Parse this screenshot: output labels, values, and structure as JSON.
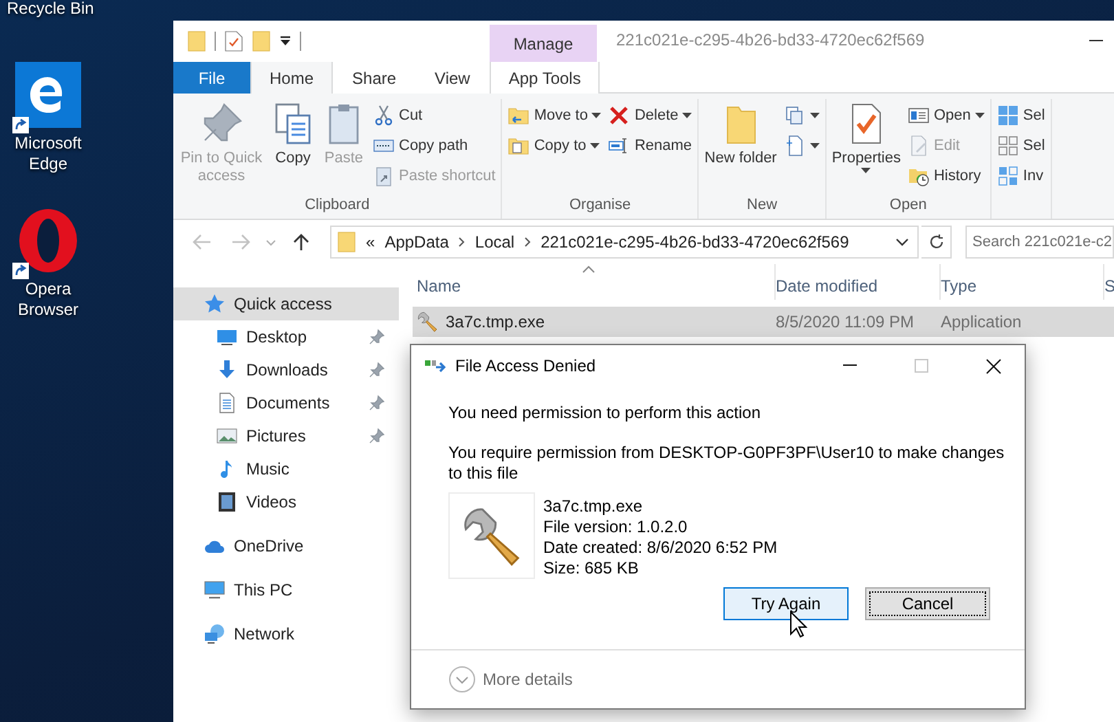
{
  "desktop": {
    "label": "Recycle Bin",
    "icons": [
      {
        "kind": "edge",
        "label": "Microsoft Edge"
      },
      {
        "kind": "opera",
        "label": "Opera Browser"
      }
    ]
  },
  "explorer": {
    "title": "221c021e-c295-4b26-bd33-4720ec62f569",
    "context_label": "Manage",
    "tabs": [
      {
        "label": "File",
        "kind": "menu",
        "selected": false
      },
      {
        "label": "Home",
        "kind": "tab",
        "selected": true
      },
      {
        "label": "Share",
        "kind": "tab",
        "selected": false
      },
      {
        "label": "View",
        "kind": "tab",
        "selected": false
      },
      {
        "label": "App Tools",
        "kind": "context",
        "selected": false
      }
    ],
    "ribbon": [
      {
        "name": "Clipboard",
        "columns": [
          {
            "kind": "large",
            "items": [
              {
                "kind": "pin",
                "label": "Pin to Quick access",
                "disabled": true,
                "dropdown": false
              }
            ]
          },
          {
            "kind": "large",
            "items": [
              {
                "kind": "copy",
                "label": "Copy",
                "disabled": false,
                "dropdown": false
              }
            ]
          },
          {
            "kind": "large",
            "items": [
              {
                "kind": "paste",
                "label": "Paste",
                "disabled": true,
                "dropdown": false
              }
            ]
          },
          {
            "kind": "stack",
            "items": [
              {
                "kind": "cut",
                "label": "Cut",
                "disabled": false,
                "dropdown": false
              },
              {
                "kind": "copypath",
                "label": "Copy path",
                "disabled": false,
                "dropdown": false
              },
              {
                "kind": "pasteshortcut",
                "label": "Paste shortcut",
                "disabled": true,
                "dropdown": false
              }
            ]
          }
        ]
      },
      {
        "name": "Organise",
        "columns": [
          {
            "kind": "stack",
            "items": [
              {
                "kind": "moveto",
                "label": "Move to",
                "disabled": false,
                "dropdown": true
              },
              {
                "kind": "copyto",
                "label": "Copy to",
                "disabled": false,
                "dropdown": true
              }
            ]
          },
          {
            "kind": "stack",
            "items": [
              {
                "kind": "delete",
                "label": "Delete",
                "disabled": false,
                "dropdown": true
              },
              {
                "kind": "rename",
                "label": "Rename",
                "disabled": false,
                "dropdown": false
              }
            ]
          }
        ]
      },
      {
        "name": "New",
        "columns": [
          {
            "kind": "large",
            "items": [
              {
                "kind": "newfolder",
                "label": "New folder",
                "disabled": false,
                "dropdown": false
              }
            ]
          },
          {
            "kind": "stack",
            "items": [
              {
                "kind": "newitem",
                "disabled": false,
                "dropdown": true
              },
              {
                "kind": "easyaccess",
                "disabled": false,
                "dropdown": true
              }
            ]
          }
        ]
      },
      {
        "name": "Open",
        "columns": [
          {
            "kind": "large",
            "items": [
              {
                "kind": "properties",
                "label": "Properties",
                "disabled": false,
                "dropdown": true
              }
            ]
          },
          {
            "kind": "stack",
            "items": [
              {
                "kind": "open",
                "label": "Open",
                "disabled": false,
                "dropdown": true
              },
              {
                "kind": "edit",
                "label": "Edit",
                "disabled": true,
                "dropdown": false
              },
              {
                "kind": "history",
                "label": "History",
                "disabled": false,
                "dropdown": false
              }
            ]
          }
        ]
      },
      {
        "columns": [
          {
            "kind": "stack",
            "items": [
              {
                "kind": "selectall",
                "label": "Sel",
                "disabled": false,
                "dropdown": false
              },
              {
                "kind": "selectnone",
                "label": "Sel",
                "disabled": false,
                "dropdown": false
              },
              {
                "kind": "invert",
                "label": "Inv",
                "disabled": false,
                "dropdown": false
              }
            ]
          }
        ]
      }
    ],
    "address": {
      "overflow": "«",
      "segments": [
        "AppData",
        "Local",
        "221c021e-c295-4b26-bd33-4720ec62f569"
      ]
    },
    "search": {
      "placeholder": "Search 221c021e-c2"
    },
    "nav": [
      {
        "label": "Quick access",
        "kind": "star",
        "selected": true,
        "pinned": false,
        "children": [
          {
            "label": "Desktop",
            "kind": "desktop",
            "selected": false,
            "pinned": true
          },
          {
            "label": "Downloads",
            "kind": "downloads",
            "selected": false,
            "pinned": true
          },
          {
            "label": "Documents",
            "kind": "documents",
            "selected": false,
            "pinned": true
          },
          {
            "label": "Pictures",
            "kind": "pictures",
            "selected": false,
            "pinned": true
          },
          {
            "label": "Music",
            "kind": "music",
            "selected": false,
            "pinned": false
          },
          {
            "label": "Videos",
            "kind": "videos",
            "selected": false,
            "pinned": false
          }
        ]
      },
      {
        "label": "OneDrive",
        "kind": "cloud",
        "selected": false,
        "pinned": false
      },
      {
        "label": "This PC",
        "kind": "pc",
        "selected": false,
        "pinned": false
      },
      {
        "label": "Network",
        "kind": "network",
        "selected": false,
        "pinned": false
      }
    ],
    "columns": [
      "Name",
      "Date modified",
      "Type",
      "S"
    ],
    "rows": [
      {
        "cells": [
          "3a7c.tmp.exe",
          "8/5/2020 11:09 PM",
          "Application"
        ],
        "selected": true
      }
    ]
  },
  "dialog": {
    "title": "File Access Denied",
    "heading": "You need permission to perform this action",
    "message": "You require permission from DESKTOP-G0PF3PF\\User10 to make changes to this file",
    "file_details": [
      "3a7c.tmp.exe",
      "File version: 1.0.2.0",
      "Date created: 8/6/2020 6:52 PM",
      "Size: 685 KB"
    ],
    "buttons": [
      {
        "label": "Try Again",
        "hovered": true,
        "focused": false
      },
      {
        "label": "Cancel",
        "hovered": false,
        "focused": true
      }
    ],
    "more_details": "More details"
  }
}
